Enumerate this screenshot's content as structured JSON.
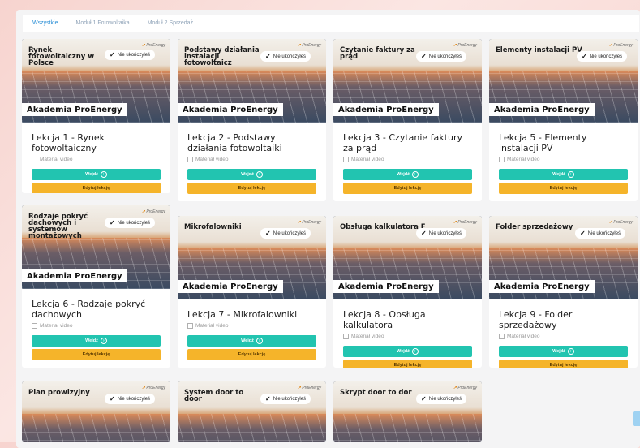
{
  "tabs": [
    {
      "label": "Wszystkie",
      "active": true
    },
    {
      "label": "Moduł 1 Fotowoltaika",
      "active": false
    },
    {
      "label": "Moduł 2 Sprzedaż",
      "active": false
    }
  ],
  "common": {
    "status_label": "Nie ukończyłeś",
    "brand_label": "Akademia ProEnergy",
    "logo_label": "ProEnergy",
    "material_label": "Materiał video",
    "go_label": "Wejdź",
    "edit_label": "Edytuj lekcję"
  },
  "cards": [
    {
      "thumb_title": "Rynek fotowoltaiczny w Polsce",
      "lesson": "Lekcja 1 - Rynek fotowoltaiczny"
    },
    {
      "thumb_title": "Podstawy działania instalacji fotowoltaicz",
      "lesson": "Lekcja 2 - Podstawy działania fotowoltaiki"
    },
    {
      "thumb_title": "Czytanie faktury za prąd",
      "lesson": "Lekcja 3 - Czytanie faktury za prąd"
    },
    {
      "thumb_title": "Elementy instalacji PV",
      "lesson": "Lekcja 5 - Elementy instalacji PV"
    },
    {
      "thumb_title": "Rodzaje pokryć dachowych i systemów montażowych",
      "lesson": "Lekcja 6 - Rodzaje pokryć dachowych"
    },
    {
      "thumb_title": "Mikrofalowniki",
      "lesson": "Lekcja 7 - Mikrofalowniki"
    },
    {
      "thumb_title": "Obsługa kalkulatora F",
      "lesson": "Lekcja 8 - Obsługa kalkulatora"
    },
    {
      "thumb_title": "Folder sprzedażowy",
      "lesson": "Lekcja 9 - Folder sprzedażowy"
    },
    {
      "thumb_title": "Plan prowizyjny",
      "lesson": ""
    },
    {
      "thumb_title": "System door to door",
      "lesson": ""
    },
    {
      "thumb_title": "Skrypt door to dor",
      "lesson": ""
    }
  ]
}
